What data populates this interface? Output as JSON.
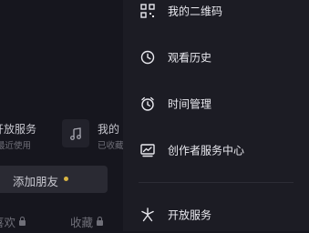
{
  "background": {
    "service_title": "开放服务",
    "service_subtitle": "最近使用",
    "music_icon": "music-note-icon",
    "mine_title": "我的",
    "mine_subtitle": "已收藏",
    "add_friend_label": "添加朋友",
    "tabs": [
      "喜欢",
      "收藏"
    ]
  },
  "drawer": {
    "items": [
      {
        "label": "我的二维码",
        "icon": "qr-code-icon"
      },
      {
        "label": "观看历史",
        "icon": "clock-icon"
      },
      {
        "label": "时间管理",
        "icon": "alarm-clock-icon"
      },
      {
        "label": "创作者服务中心",
        "icon": "chart-monitor-icon"
      },
      {
        "label": "开放服务",
        "icon": "asterisk-icon"
      }
    ]
  },
  "colors": {
    "drawer_bg": "#1c1c24",
    "page_bg": "#16161e",
    "accent_dot": "#d9b543"
  }
}
